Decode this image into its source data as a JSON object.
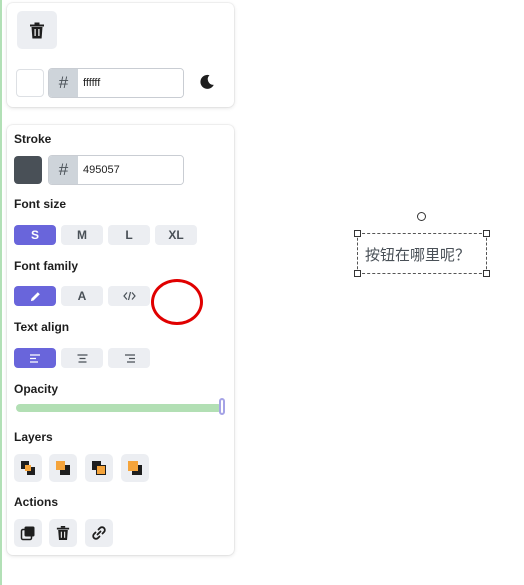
{
  "background": {
    "hex_label": "#",
    "hex_value": "ffffff",
    "swatch_color": "#ffffff"
  },
  "stroke": {
    "label": "Stroke",
    "hex_label": "#",
    "hex_value": "495057",
    "swatch_color": "#495057"
  },
  "font_size": {
    "label": "Font size",
    "options": [
      "S",
      "M",
      "L",
      "XL"
    ],
    "selected": "S"
  },
  "font_family": {
    "label": "Font family",
    "options": [
      {
        "icon": "pencil-icon"
      },
      {
        "text": "A"
      },
      {
        "icon": "code-icon"
      }
    ],
    "selected_index": 0
  },
  "text_align": {
    "label": "Text align",
    "options": [
      "align-left-icon",
      "align-center-icon",
      "align-right-icon"
    ],
    "selected_index": 0
  },
  "opacity": {
    "label": "Opacity",
    "value_percent": 100
  },
  "layers": {
    "label": "Layers",
    "buttons": [
      "send-to-back-icon",
      "send-backward-icon",
      "bring-forward-icon",
      "bring-to-front-icon"
    ]
  },
  "actions": {
    "label": "Actions",
    "buttons": [
      "duplicate-icon",
      "delete-icon",
      "link-icon"
    ]
  },
  "canvas": {
    "text": "按钮在哪里呢？"
  },
  "colors": {
    "accent": "#6965db",
    "annotation": "#e00000",
    "slider": "#b2dfb4"
  }
}
